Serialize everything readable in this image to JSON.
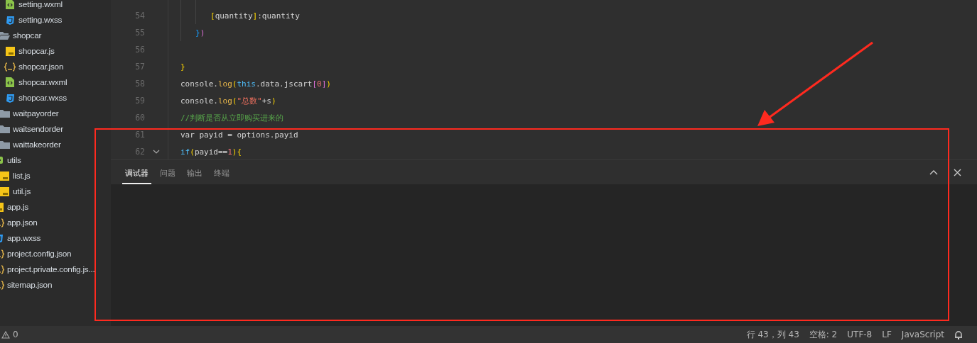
{
  "file_tree": [
    {
      "children": [
        {
          "children": [
            {
              "name": "setting.wxml",
              "kind": "wxml"
            },
            {
              "name": "setting.wxss",
              "kind": "wxss"
            }
          ]
        },
        {
          "name": "shopcar",
          "kind": "folder",
          "expanded": true,
          "children": [
            {
              "name": "shopcar.js",
              "kind": "js"
            },
            {
              "name": "shopcar.json",
              "kind": "json"
            },
            {
              "name": "shopcar.wxml",
              "kind": "wxml"
            },
            {
              "name": "shopcar.wxss",
              "kind": "wxss"
            }
          ]
        },
        {
          "name": "waitpayorder",
          "kind": "folder",
          "expanded": false
        },
        {
          "name": "waitsendorder",
          "kind": "folder",
          "expanded": false
        },
        {
          "name": "waittakeorder",
          "kind": "folder",
          "expanded": false
        }
      ]
    },
    {
      "name": "utils",
      "kind": "package",
      "children": [
        {
          "name": "list.js",
          "kind": "js"
        },
        {
          "name": "util.js",
          "kind": "js"
        }
      ]
    },
    {
      "name": "app.js",
      "kind": "js"
    },
    {
      "name": "app.json",
      "kind": "json"
    },
    {
      "name": "app.wxss",
      "kind": "wxss"
    },
    {
      "name": "project.config.json",
      "kind": "json"
    },
    {
      "name": "project.private.config.js...",
      "kind": "json"
    },
    {
      "name": "sitemap.json",
      "kind": "json"
    }
  ],
  "editor": {
    "lines": [
      {
        "children": [
          {
            "children": [
              {
                "number": "54",
                "tokens": [
                  {
                    "text": "[",
                    "kind": "bracket1"
                  },
                  {
                    "text": "quantity",
                    "kind": "plain"
                  },
                  {
                    "text": "]",
                    "kind": "bracket1"
                  },
                  {
                    "text": ":quantity",
                    "kind": "plain"
                  }
                ]
              }
            ]
          },
          {
            "number": "55",
            "tokens": [
              {
                "text": "}",
                "kind": "bracket3"
              },
              {
                "text": ")",
                "kind": "bracket2"
              }
            ]
          }
        ]
      },
      {
        "number": "56"
      },
      {
        "number": "57",
        "tokens": [
          {
            "text": "}",
            "kind": "bracket1"
          }
        ]
      },
      {
        "number": "58",
        "tokens": [
          {
            "text": "console.",
            "kind": "plain"
          },
          {
            "text": "log",
            "kind": "func"
          },
          {
            "text": "(",
            "kind": "bracket1"
          },
          {
            "text": "this",
            "kind": "keyword"
          },
          {
            "text": ".data.jscart",
            "kind": "plain"
          },
          {
            "text": "[",
            "kind": "bracket2"
          },
          {
            "text": "0",
            "kind": "number"
          },
          {
            "text": "]",
            "kind": "bracket2"
          },
          {
            "text": ")",
            "kind": "bracket1"
          }
        ]
      },
      {
        "number": "59",
        "tokens": [
          {
            "text": "console.",
            "kind": "plain"
          },
          {
            "text": "log",
            "kind": "func"
          },
          {
            "text": "(",
            "kind": "bracket1"
          },
          {
            "text": "\"总数\"",
            "kind": "string"
          },
          {
            "text": "+s",
            "kind": "plain"
          },
          {
            "text": ")",
            "kind": "bracket1"
          }
        ]
      },
      {
        "number": "60",
        "tokens": [
          {
            "text": "//判断是否从立即购买进来的",
            "kind": "comment"
          }
        ]
      },
      {
        "number": "61",
        "tokens": [
          {
            "text": "var",
            "kind": "plain"
          },
          {
            "text": " payid = options.payid",
            "kind": "plain"
          }
        ]
      },
      {
        "number": "62",
        "foldable": true,
        "tokens": [
          {
            "text": "if",
            "kind": "keyword"
          },
          {
            "text": "(",
            "kind": "bracket1"
          },
          {
            "text": "payid==",
            "kind": "plain"
          },
          {
            "text": "1",
            "kind": "number"
          },
          {
            "text": ")",
            "kind": "bracket1"
          },
          {
            "text": "{",
            "kind": "bracket1"
          }
        ]
      }
    ]
  },
  "panel": {
    "tabs": [
      {
        "label": "调试器",
        "selected": true
      },
      {
        "label": "问题",
        "selected": false
      },
      {
        "label": "输出",
        "selected": false
      },
      {
        "label": "终端",
        "selected": false
      }
    ]
  },
  "status_bar": {
    "warnings": "0",
    "items": [
      "行 43，列 43",
      "空格: 2",
      "UTF-8",
      "LF",
      "JavaScript"
    ]
  },
  "annotations": {
    "arrow": {
      "color": "#ff2a1f"
    },
    "rectangle": {
      "color": "#ff2a1f"
    }
  }
}
